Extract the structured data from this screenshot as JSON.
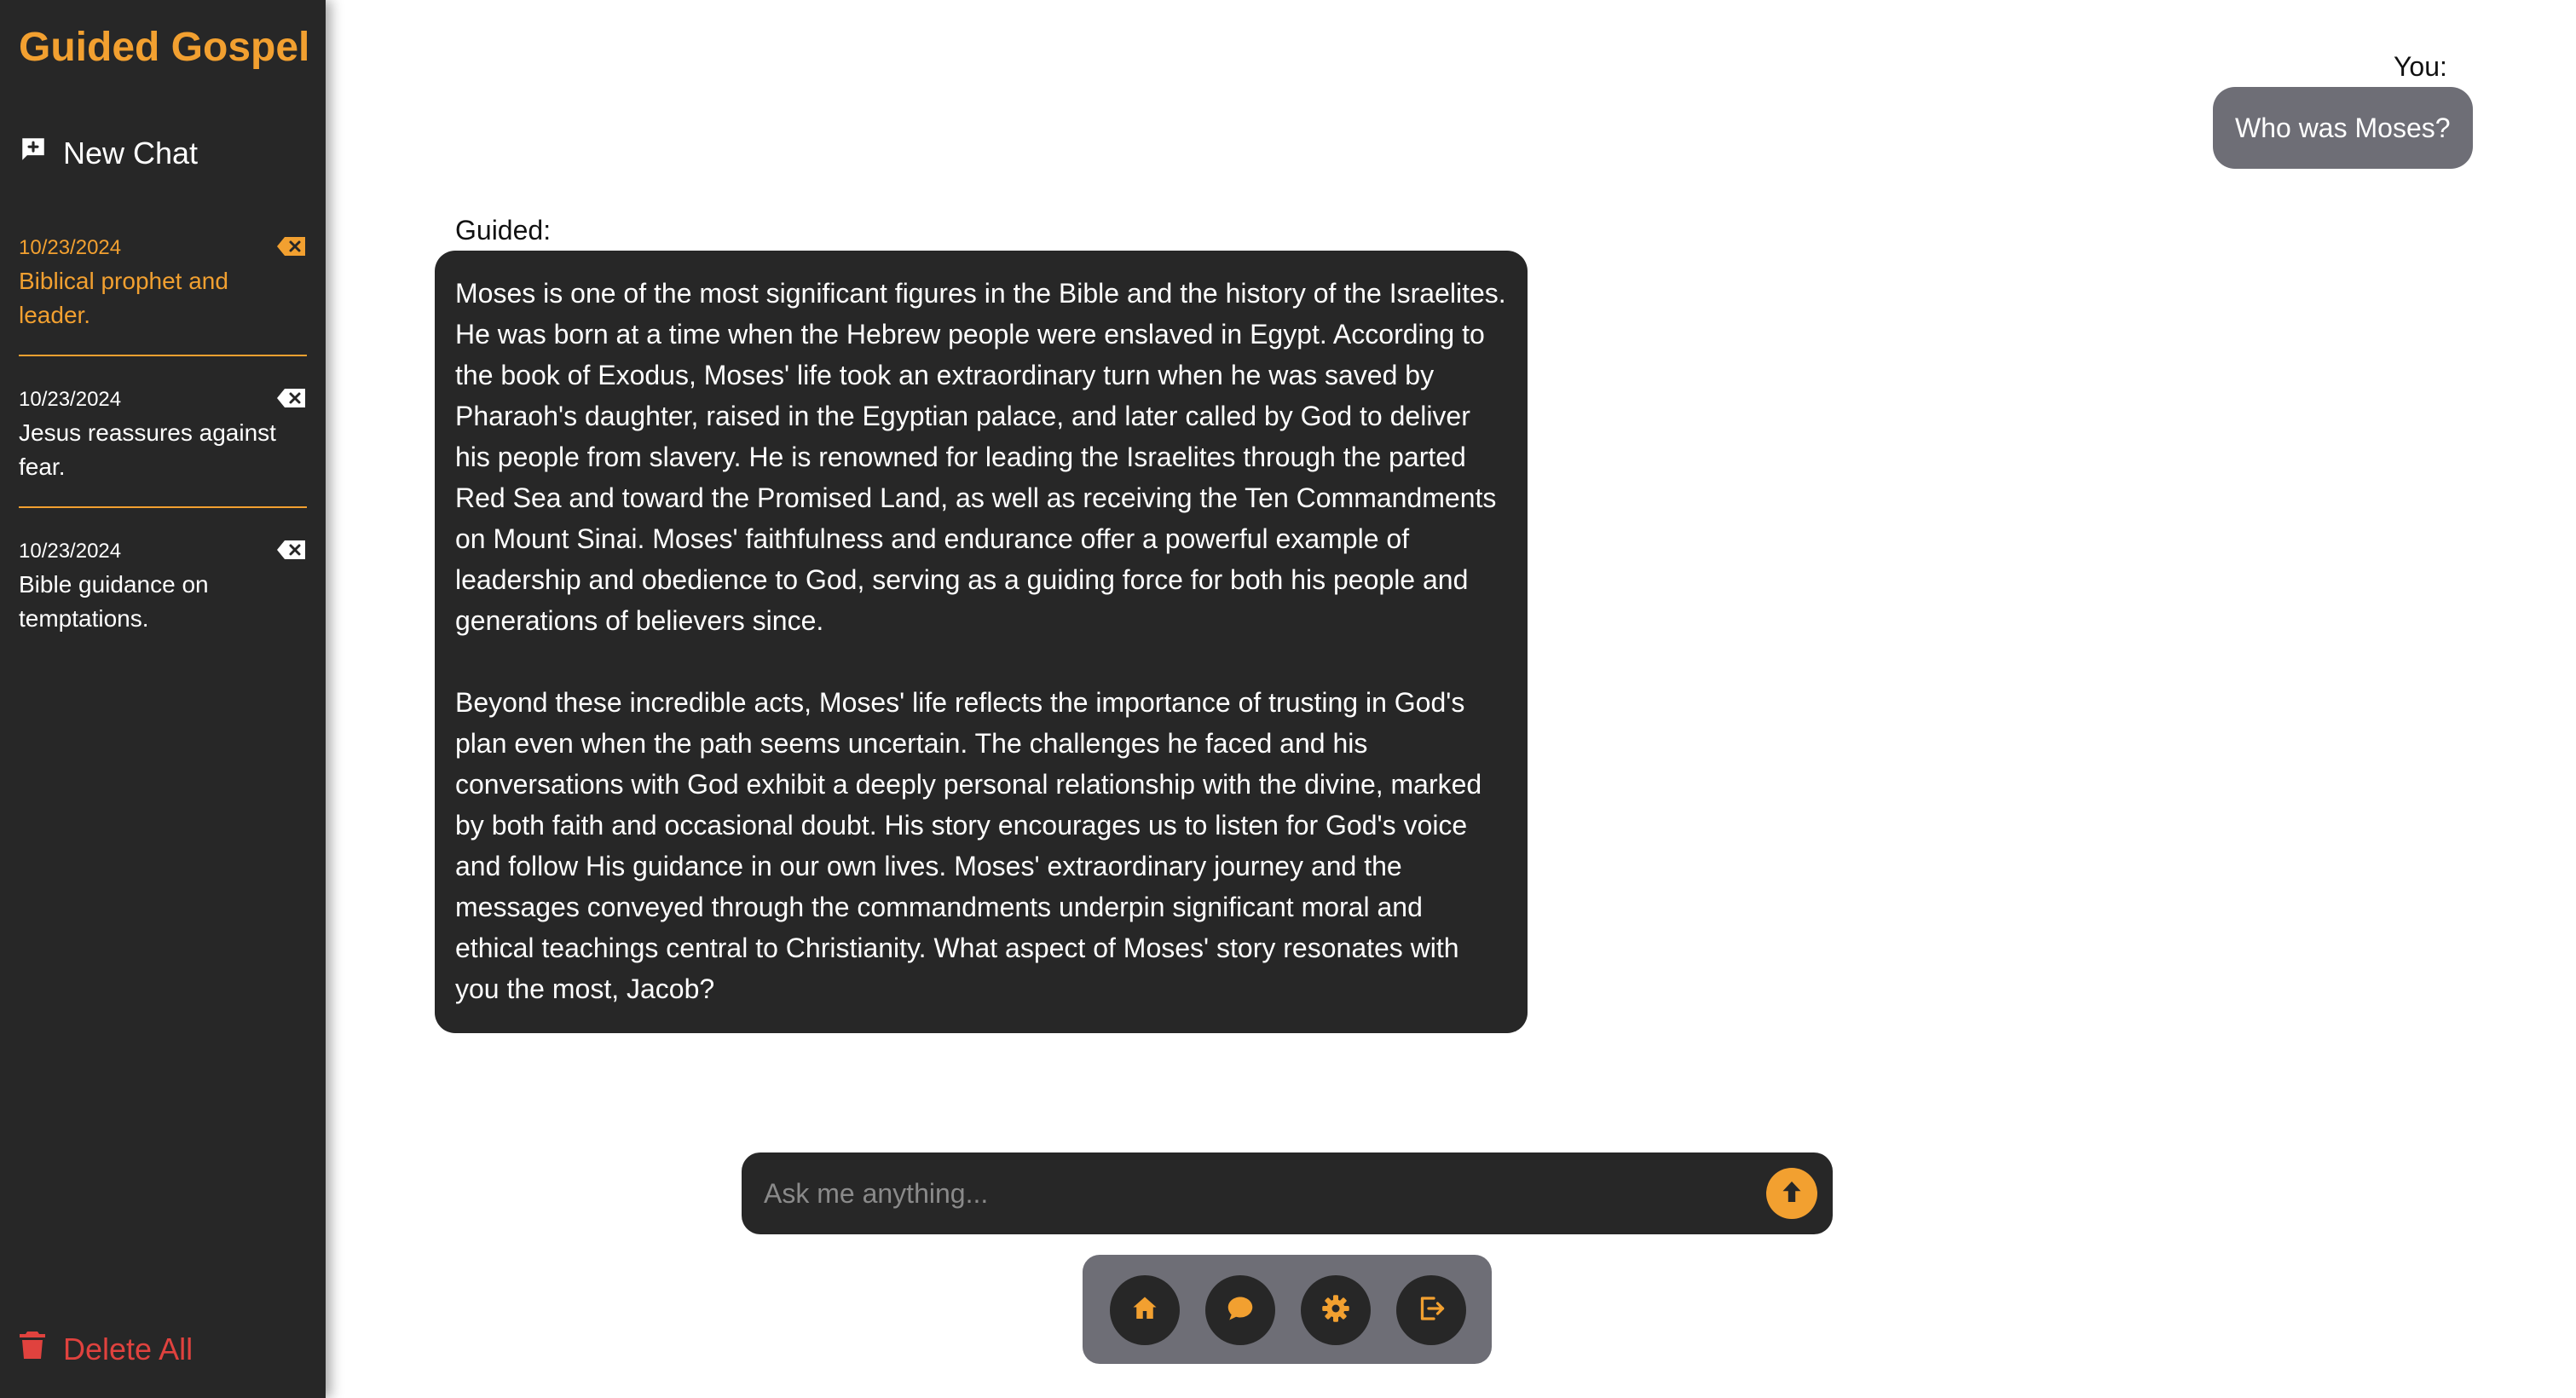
{
  "app": {
    "brand": "Guided Gospel",
    "accent_color": "#F2A030",
    "danger_color": "#E0423E"
  },
  "sidebar": {
    "new_chat_label": "New Chat",
    "new_chat_icon": "chat-plus-icon",
    "history": [
      {
        "date": "10/23/2024",
        "title": "Biblical prophet and leader.",
        "active": true
      },
      {
        "date": "10/23/2024",
        "title": "Jesus reassures against fear.",
        "active": false
      },
      {
        "date": "10/23/2024",
        "title": "Bible guidance on temptations.",
        "active": false
      }
    ],
    "delete_icon": "backspace-icon",
    "delete_all_label": "Delete All",
    "delete_all_icon": "trash-icon"
  },
  "chat": {
    "user_label": "You:",
    "user_message": "Who was Moses?",
    "assistant_label": "Guided:",
    "assistant_paragraphs": [
      "Moses is one of the most significant figures in the Bible and the history of the Israelites. He was born at a time when the Hebrew people were enslaved in Egypt. According to the book of Exodus, Moses' life took an extraordinary turn when he was saved by Pharaoh's daughter, raised in the Egyptian palace, and later called by God to deliver his people from slavery. He is renowned for leading the Israelites through the parted Red Sea and toward the Promised Land, as well as receiving the Ten Commandments on Mount Sinai. Moses' faithfulness and endurance offer a powerful example of leadership and obedience to God, serving as a guiding force for both his people and generations of believers since.",
      "Beyond these incredible acts, Moses' life reflects the importance of trusting in God's plan even when the path seems uncertain. The challenges he faced and his conversations with God exhibit a deeply personal relationship with the divine, marked by both faith and occasional doubt. His story encourages us to listen for God's voice and follow His guidance in our own lives. Moses' extraordinary journey and the messages conveyed through the commandments underpin significant moral and ethical teachings central to Christianity. What aspect of Moses' story resonates with you the most, Jacob?"
    ]
  },
  "composer": {
    "placeholder": "Ask me anything...",
    "value": "",
    "send_icon": "arrow-up-circle-icon"
  },
  "nav": {
    "buttons": [
      {
        "icon": "home-icon"
      },
      {
        "icon": "chat-bubble-icon"
      },
      {
        "icon": "gear-icon"
      },
      {
        "icon": "logout-icon"
      }
    ]
  }
}
